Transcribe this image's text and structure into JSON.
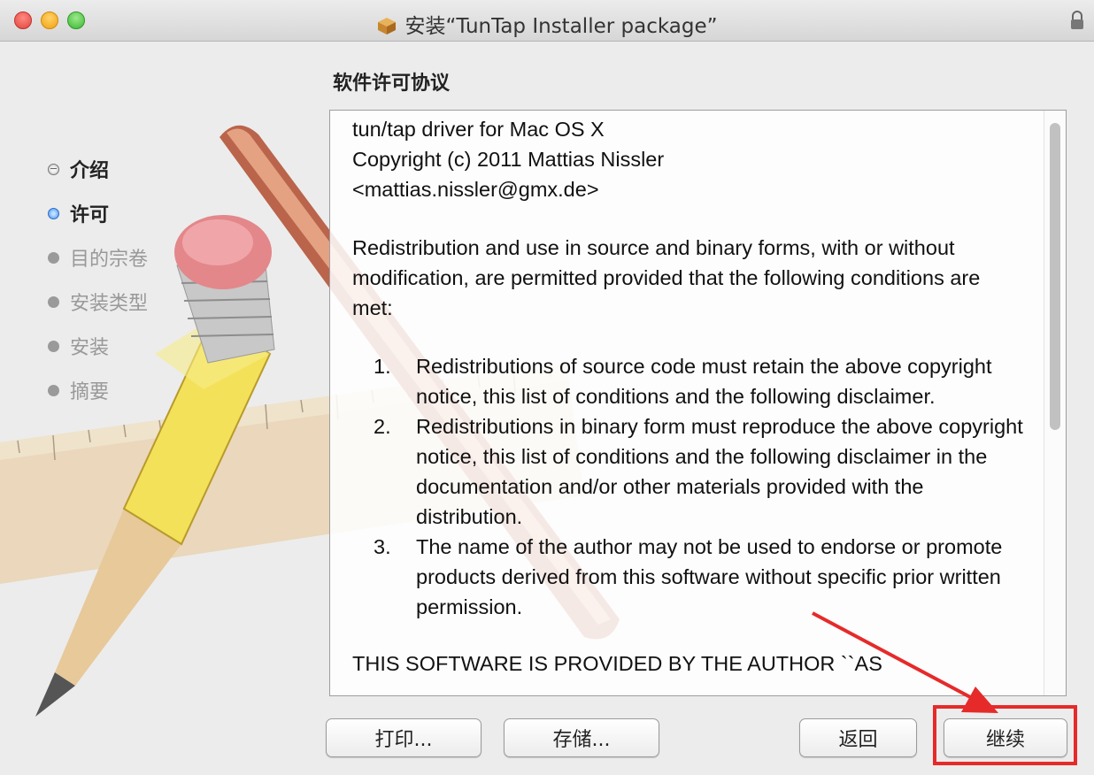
{
  "window": {
    "title": "安装“TunTap Installer package”"
  },
  "heading": "软件许可协议",
  "steps": [
    {
      "label": "介绍",
      "state": "done"
    },
    {
      "label": "许可",
      "state": "current"
    },
    {
      "label": "目的宗卷",
      "state": "pending"
    },
    {
      "label": "安装类型",
      "state": "pending"
    },
    {
      "label": "安装",
      "state": "pending"
    },
    {
      "label": "摘要",
      "state": "pending"
    }
  ],
  "license": {
    "header_lines": [
      "tun/tap driver for Mac OS X",
      "Copyright (c) 2011 Mattias Nissler",
      "<mattias.nissler@gmx.de>"
    ],
    "intro": "Redistribution and use in source and binary forms, with or without modification, are permitted provided that the following conditions are met:",
    "items": [
      {
        "num": "1.",
        "text": "Redistributions of source code must retain the above copyright notice, this list of conditions and the following disclaimer."
      },
      {
        "num": "2.",
        "text": "Redistributions in binary form must reproduce the above copyright notice, this list of conditions and the following disclaimer in the documentation and/or other materials provided with the distribution."
      },
      {
        "num": "3.",
        "text": "The name of the author may not be used to endorse or promote products derived from this software without specific prior written permission."
      }
    ],
    "trailing": "THIS SOFTWARE IS PROVIDED BY THE AUTHOR ``AS"
  },
  "buttons": {
    "print": "打印...",
    "save": "存储...",
    "back": "返回",
    "continue": "继续"
  },
  "colors": {
    "highlight": "#e62a2a",
    "current_step": "#3c8ef0"
  },
  "icons": {
    "window_icon": "package-icon",
    "lock": "lock-icon"
  }
}
